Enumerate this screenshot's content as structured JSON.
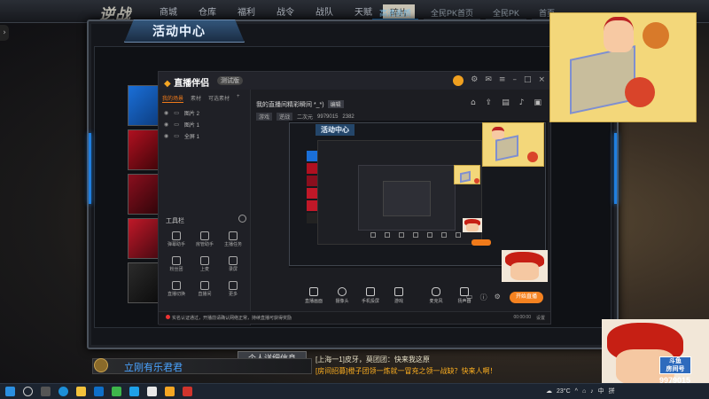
{
  "game": {
    "logo": "逆战",
    "menu": [
      "商城",
      "仓库",
      "福利",
      "战令",
      "战队",
      "天赋",
      "碎片"
    ],
    "menu_active": "碎片",
    "top_tabs": [
      "高清画质",
      "全民PK首页",
      "全民PK",
      "首页"
    ]
  },
  "activity_panel": {
    "title": "活动中心"
  },
  "streaming_app": {
    "logo": "直播伴侣",
    "badge": "测试版",
    "tabs": [
      "我的场景",
      "素材",
      "可选素材"
    ],
    "scenes": [
      {
        "label": "图片 2"
      },
      {
        "label": "图片 1"
      },
      {
        "label": "全屏 1"
      }
    ],
    "stream_title": "我的直播间精彩瞬间 *_*)",
    "edit_label": "编辑",
    "tags": [
      "游戏",
      "逆战",
      "9979015",
      "2382"
    ],
    "tag_extra": "二次元",
    "tools_title": "工具栏",
    "tools": [
      {
        "label": "弹幕助手"
      },
      {
        "label": "房管助手"
      },
      {
        "label": "主播任务"
      },
      {
        "label": "粉丝团"
      },
      {
        "label": "上麦"
      },
      {
        "label": "录屏"
      },
      {
        "label": "直播切换"
      },
      {
        "label": "直播间"
      },
      {
        "label": "更多"
      }
    ],
    "bottom_tools": [
      {
        "label": "直播画面"
      },
      {
        "label": "摄像头"
      },
      {
        "label": "手机投屏"
      },
      {
        "label": "游戏"
      },
      {
        "label": "麦克风"
      },
      {
        "label": "扬声器"
      }
    ],
    "live_button": "开始直播",
    "status_text": "实名认证通过，开播前请确认网络正常，持续直播可获得奖励",
    "status_right": [
      "00:00:00",
      "设置"
    ]
  },
  "nested": {
    "title": "活动中心"
  },
  "bottom": {
    "username": "立刚有乐君君",
    "detail_button": "个人详细信息",
    "chat": [
      {
        "prefix": "",
        "text": "[上海一1]皮牙，莫团团：快来我这原"
      },
      {
        "prefix": "[房间招募]",
        "text": "橙子团领一炼就一冒充之领一战缺？快来人啊！"
      }
    ]
  },
  "webcam": {
    "id": "9979015",
    "badge_line1": "斗鱼",
    "badge_line2": "房间号"
  },
  "taskbar": {
    "weather": "23°C",
    "tray": [
      "中",
      "拼"
    ]
  }
}
